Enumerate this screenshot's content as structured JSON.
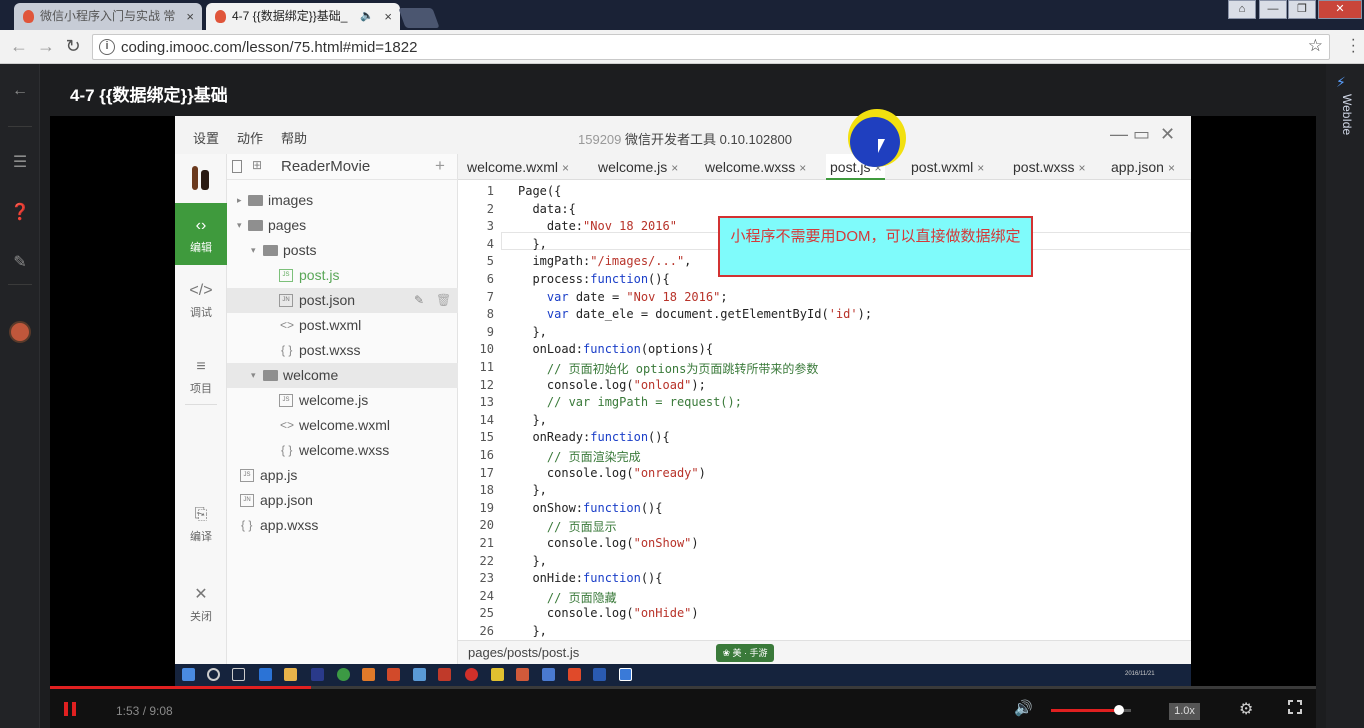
{
  "browser": {
    "tabs": [
      {
        "title": "微信小程序入门与实战 常",
        "close": "×"
      },
      {
        "title": "4-7 {{数据绑定}}基础_",
        "close": "×"
      }
    ],
    "url": "coding.imooc.com/lesson/75.html#mid=1822",
    "info_glyph": "i",
    "star_glyph": "☆"
  },
  "lesson": {
    "title": "4-7 {{数据绑定}}基础",
    "right_label": "WebIde"
  },
  "ide": {
    "menu": [
      "设置",
      "动作",
      "帮助"
    ],
    "id_prefix": "159209",
    "window_title": "微信开发者工具 0.10.102800",
    "project": "ReaderMovie",
    "add_glyph": "+",
    "side_nav": [
      {
        "label": "编辑",
        "icon": "‹›"
      },
      {
        "label": "调试",
        "icon": "</>"
      },
      {
        "label": "项目",
        "icon": "≡"
      },
      {
        "label": "编译",
        "icon": "⎘"
      },
      {
        "label": "关闭",
        "icon": "✕"
      }
    ],
    "tree": [
      "images",
      "pages",
      "posts",
      "post.js",
      "post.json",
      "post.wxml",
      "post.wxss",
      "welcome",
      "welcome.js",
      "welcome.wxml",
      "welcome.wxss",
      "app.js",
      "app.json",
      "app.wxss"
    ],
    "editor_tabs": [
      "welcome.wxml",
      "welcome.js",
      "welcome.wxss",
      "post.js",
      "post.wxml",
      "post.wxss",
      "app.json"
    ],
    "close_glyph": "×",
    "code": [
      "Page({",
      "  data:{",
      "    date:\"Nov 18 2016\"",
      "  },",
      "  imgPath:\"/images/...\",",
      "  process:function(){",
      "    var date = \"Nov 18 2016\";",
      "    var date_ele = document.getElementById('id');",
      "  },",
      "  onLoad:function(options){",
      "    // 页面初始化 options为页面跳转所带来的参数",
      "    console.log(\"onload\");",
      "    // var imgPath = request();",
      "  },",
      "  onReady:function(){",
      "    // 页面渲染完成",
      "    console.log(\"onready\")",
      "  },",
      "  onShow:function(){",
      "    // 页面显示",
      "    console.log(\"onShow\")",
      "  },",
      "  onHide:function(){",
      "    // 页面隐藏",
      "    console.log(\"onHide\")",
      "  },"
    ],
    "line_numbers": [
      "1",
      "2",
      "3",
      "4",
      "5",
      "6",
      "7",
      "8",
      "9",
      "10",
      "11",
      "12",
      "13",
      "14",
      "15",
      "16",
      "17",
      "18",
      "19",
      "20",
      "21",
      "22",
      "23",
      "24",
      "25",
      "26"
    ],
    "callout": "小程序不需要用DOM，可以直接做数据绑定",
    "status_path": "pages/posts/post.js",
    "status_badge": "❀ 美 · 手游",
    "tray_date": "2016/11/21"
  },
  "player": {
    "time": "1:53 / 9:08",
    "progress": 0.206,
    "volume": 0.85,
    "speed": "1.0x"
  },
  "colors": {
    "accent_green": "#3f9a3d",
    "callout_bg": "#7ffbfb",
    "callout_border": "#d23232",
    "progress_red": "#e02020"
  }
}
